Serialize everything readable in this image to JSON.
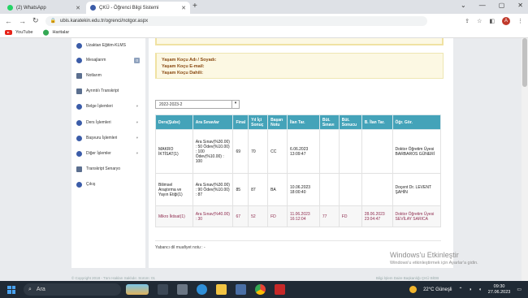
{
  "browser": {
    "tabs": [
      {
        "label": "(2) WhatsApp",
        "active": false
      },
      {
        "label": "ÇKÜ - Öğrenci Bilgi Sistemi",
        "active": true
      }
    ],
    "url": "ubis.karatekin.edu.tr/ogrenci/notgor.aspx",
    "bookmarks": [
      "YouTube",
      "Haritalar"
    ],
    "profile_initial": "A",
    "accent": "#c0392b"
  },
  "sidebar": {
    "items": [
      {
        "label": "Uzaktan Eğitim-KLMS",
        "icon": "globe-icon"
      },
      {
        "label": "Mesajlarım",
        "icon": "message-icon",
        "badge": "0"
      },
      {
        "label": "Notlarım",
        "icon": "grades-icon"
      },
      {
        "label": "Ayrıntılı Transkript",
        "icon": "document-icon"
      },
      {
        "label": "Belge İşlemleri",
        "icon": "folder-icon",
        "expandable": true
      },
      {
        "label": "Ders İşlemleri",
        "icon": "book-icon",
        "expandable": true
      },
      {
        "label": "Başvuru İşlemleri",
        "icon": "form-icon",
        "expandable": true
      },
      {
        "label": "Diğer İşlemler",
        "icon": "settings-icon",
        "expandable": true
      },
      {
        "label": "Transkript Senaryo",
        "icon": "list-icon"
      },
      {
        "label": "Çıkış",
        "icon": "logout-icon"
      }
    ]
  },
  "koc": {
    "name_label": "Yaşam Koçu Adı / Soyadı:",
    "email_label": "Yaşam Koçu E-mail:",
    "phone_label": "Yaşam Koçu Dahili:"
  },
  "term_select": {
    "value": "2022-2023-2"
  },
  "grades": {
    "headers": [
      "Ders(Şube)",
      "Ara Sınavlar",
      "Final",
      "Yıl İçi Sonuç",
      "Başarı Notu",
      "İlan Tar.",
      "Büt. Sınavı",
      "Büt. Sonucu",
      "B. İlan Tar.",
      "Öğr. Gör."
    ],
    "rows": [
      [
        "MAKRO İKTİSAT(1)",
        "Ara Sınav(%30.00) : 50 Ödev(%10.00) : 100 Ödev(%10.00) : 100",
        "69",
        "70",
        "CC",
        "6.06.2023 13:09:47",
        "",
        "",
        "",
        "Doktor Öğretim Üyesi BARBAROS GÜNERİ"
      ],
      [
        "Bilimsel Araştırma ve Yayın Etiği(1)",
        "Ara Sınav(%30.00) : 90 Ödev(%10.00) : 87",
        "85",
        "87",
        "BA",
        "10.06.2023 18:00:40",
        "",
        "",
        "",
        "Doçent Dr. LEVENT ŞAHİN"
      ],
      [
        "Mikro İktisat(1)",
        "Ara Sınav(%40.00) : 30",
        "67",
        "52",
        "FD",
        "11.06.2023 16:12:04",
        "77",
        "FD",
        "28.06.2023 23:04:47",
        "Doktor Öğretim Üyesi SEVİLAY SARICA"
      ]
    ]
  },
  "note": "Yabancı dil muafiyet notu : -",
  "footer": {
    "left": "© Copyright 2018 - Tüm Hakları Saklıdır. Sürüm: 01",
    "right": "Bilgi İşlem Daire Başkanlığı ÇKÜ BİDB"
  },
  "watermark": {
    "line1": "Windows'u Etkinleştir",
    "line2": "Windows'u etkinleştirmek için Ayarlar'a gidin."
  },
  "taskbar": {
    "search_placeholder": "Ara",
    "weather": "22°C Güneşli",
    "time": "09:30",
    "date": "27.06.2023"
  }
}
